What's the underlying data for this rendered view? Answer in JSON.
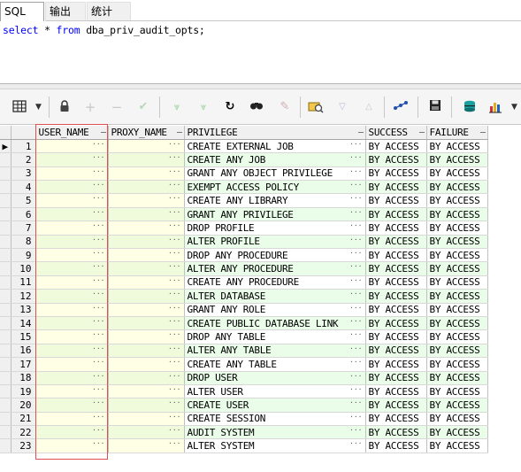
{
  "tabs": [
    {
      "label": "SQL",
      "active": true
    },
    {
      "label": "输出",
      "active": false
    },
    {
      "label": "统计",
      "active": false
    }
  ],
  "editor": {
    "sql_keyword_select": "select",
    "sql_star": "*",
    "sql_keyword_from": "from",
    "sql_table": "dba_priv_audit_opts;"
  },
  "toolbar": {
    "icons": [
      "grid-view-icon",
      "dropdown-arrow-icon",
      "lock-icon",
      "add-row-icon",
      "delete-row-icon",
      "post-changes-icon",
      "fetch-next-icon",
      "fetch-last-icon",
      "refresh-icon",
      "find-icon",
      "clear-icon",
      "query-by-example-icon",
      "previous-icon",
      "next-icon",
      "explain-plan-icon",
      "save-icon",
      "export-icon",
      "chart-icon",
      "dropdown-arrow-icon"
    ]
  },
  "grid": {
    "columns": [
      "USER_NAME",
      "PROXY_NAME",
      "PRIVILEGE",
      "SUCCESS",
      "FAILURE"
    ],
    "rows": [
      {
        "n": "1",
        "privilege": "CREATE EXTERNAL JOB",
        "success": "BY ACCESS",
        "failure": "BY ACCESS"
      },
      {
        "n": "2",
        "privilege": "CREATE ANY JOB",
        "success": "BY ACCESS",
        "failure": "BY ACCESS"
      },
      {
        "n": "3",
        "privilege": "GRANT ANY OBJECT PRIVILEGE",
        "success": "BY ACCESS",
        "failure": "BY ACCESS"
      },
      {
        "n": "4",
        "privilege": "EXEMPT ACCESS POLICY",
        "success": "BY ACCESS",
        "failure": "BY ACCESS"
      },
      {
        "n": "5",
        "privilege": "CREATE ANY LIBRARY",
        "success": "BY ACCESS",
        "failure": "BY ACCESS"
      },
      {
        "n": "6",
        "privilege": "GRANT ANY PRIVILEGE",
        "success": "BY ACCESS",
        "failure": "BY ACCESS"
      },
      {
        "n": "7",
        "privilege": "DROP PROFILE",
        "success": "BY ACCESS",
        "failure": "BY ACCESS"
      },
      {
        "n": "8",
        "privilege": "ALTER PROFILE",
        "success": "BY ACCESS",
        "failure": "BY ACCESS"
      },
      {
        "n": "9",
        "privilege": "DROP ANY PROCEDURE",
        "success": "BY ACCESS",
        "failure": "BY ACCESS"
      },
      {
        "n": "10",
        "privilege": "ALTER ANY PROCEDURE",
        "success": "BY ACCESS",
        "failure": "BY ACCESS"
      },
      {
        "n": "11",
        "privilege": "CREATE ANY PROCEDURE",
        "success": "BY ACCESS",
        "failure": "BY ACCESS"
      },
      {
        "n": "12",
        "privilege": "ALTER DATABASE",
        "success": "BY ACCESS",
        "failure": "BY ACCESS"
      },
      {
        "n": "13",
        "privilege": "GRANT ANY ROLE",
        "success": "BY ACCESS",
        "failure": "BY ACCESS"
      },
      {
        "n": "14",
        "privilege": "CREATE PUBLIC DATABASE LINK",
        "success": "BY ACCESS",
        "failure": "BY ACCESS"
      },
      {
        "n": "15",
        "privilege": "DROP ANY TABLE",
        "success": "BY ACCESS",
        "failure": "BY ACCESS"
      },
      {
        "n": "16",
        "privilege": "ALTER ANY TABLE",
        "success": "BY ACCESS",
        "failure": "BY ACCESS"
      },
      {
        "n": "17",
        "privilege": "CREATE ANY TABLE",
        "success": "BY ACCESS",
        "failure": "BY ACCESS"
      },
      {
        "n": "18",
        "privilege": "DROP USER",
        "success": "BY ACCESS",
        "failure": "BY ACCESS"
      },
      {
        "n": "19",
        "privilege": "ALTER USER",
        "success": "BY ACCESS",
        "failure": "BY ACCESS"
      },
      {
        "n": "20",
        "privilege": "CREATE USER",
        "success": "BY ACCESS",
        "failure": "BY ACCESS"
      },
      {
        "n": "21",
        "privilege": "CREATE SESSION",
        "success": "BY ACCESS",
        "failure": "BY ACCESS"
      },
      {
        "n": "22",
        "privilege": "AUDIT SYSTEM",
        "success": "BY ACCESS",
        "failure": "BY ACCESS"
      },
      {
        "n": "23",
        "privilege": "ALTER SYSTEM",
        "success": "BY ACCESS",
        "failure": "BY ACCESS"
      }
    ]
  },
  "colors": {
    "even_row": "#e9fde9",
    "highlight_box": "#e05050",
    "sql_keyword": "#0000ff"
  }
}
